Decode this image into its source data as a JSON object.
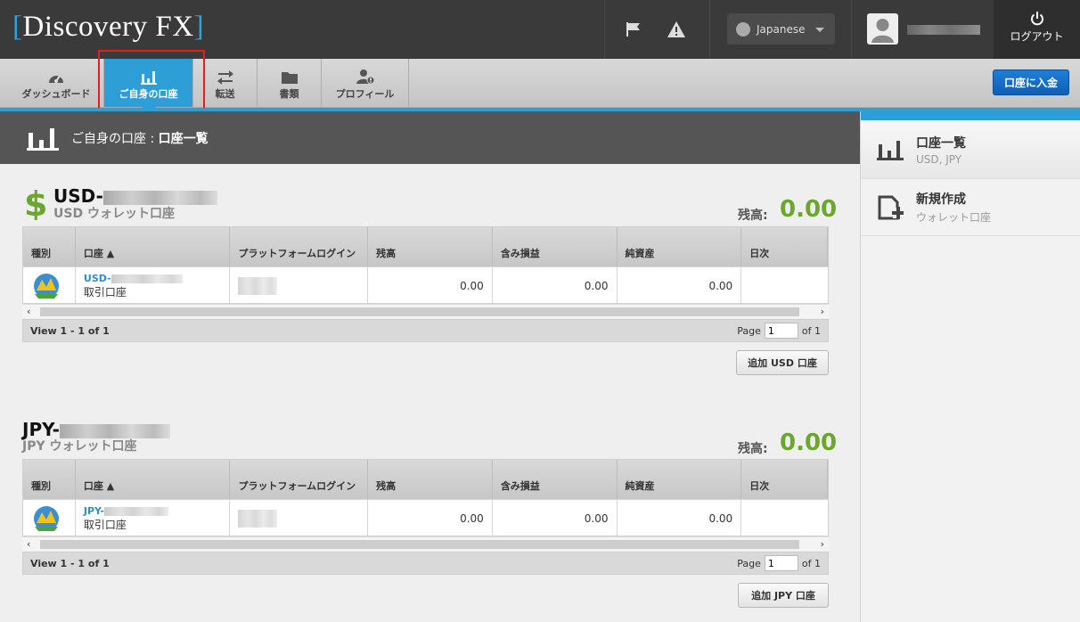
{
  "header": {
    "logo_open": "[",
    "logo_text": "Discovery FX",
    "logo_close": "]",
    "language": "Japanese",
    "logout_label": "ログアウト",
    "icons": [
      "flag-icon",
      "warning-icon",
      "globe-icon",
      "user-icon",
      "power-icon"
    ]
  },
  "nav": {
    "items": [
      {
        "label": "ダッシュボード",
        "icon": "dashboard-icon"
      },
      {
        "label": "ご自身の口座",
        "icon": "bar-chart-icon"
      },
      {
        "label": "転送",
        "icon": "transfer-icon"
      },
      {
        "label": "書類",
        "icon": "folder-icon"
      },
      {
        "label": "プロフィール",
        "icon": "profile-icon"
      }
    ],
    "active": "ご自身の口座",
    "deposit_label": "口座に入金"
  },
  "page": {
    "title_prefix": "ご自身の口座 : ",
    "title_main": "口座一覧"
  },
  "sidebar": {
    "items": [
      {
        "title": "口座一覧",
        "subtitle": "USD, JPY"
      },
      {
        "title": "新規作成",
        "subtitle": "ウォレット口座"
      }
    ]
  },
  "columns": [
    "種別",
    "口座 ▲",
    "プラットフォームログイン",
    "残高",
    "含み損益",
    "純資産",
    "日次"
  ],
  "usd": {
    "title": "USD-",
    "subtitle": "USD ウォレット口座",
    "balance_label": "残高:",
    "balance_value": "0.00",
    "row": {
      "account_link": "USD-",
      "account_type": "取引口座",
      "balance": "0.00",
      "unrealized": "0.00",
      "equity": "0.00"
    },
    "view_text": "View 1 - 1 of 1",
    "page_label": "Page",
    "page_value": "1",
    "page_of": "of 1",
    "add_label": "追加 USD 口座"
  },
  "jpy": {
    "title": "JPY-",
    "subtitle": "JPY ウォレット口座",
    "balance_label": "残高:",
    "balance_value": "0.00",
    "row": {
      "account_link": "JPY-",
      "account_type": "取引口座",
      "balance": "0.00",
      "unrealized": "0.00",
      "equity": "0.00"
    },
    "view_text": "View 1 - 1 of 1",
    "page_label": "Page",
    "page_value": "1",
    "page_of": "of 1",
    "add_label": "追加 JPY 口座"
  },
  "colors": {
    "accent": "#2e9fd6",
    "balance": "#6aa72c",
    "header": "#3a3a3a",
    "highlight": "#e41e1e"
  }
}
